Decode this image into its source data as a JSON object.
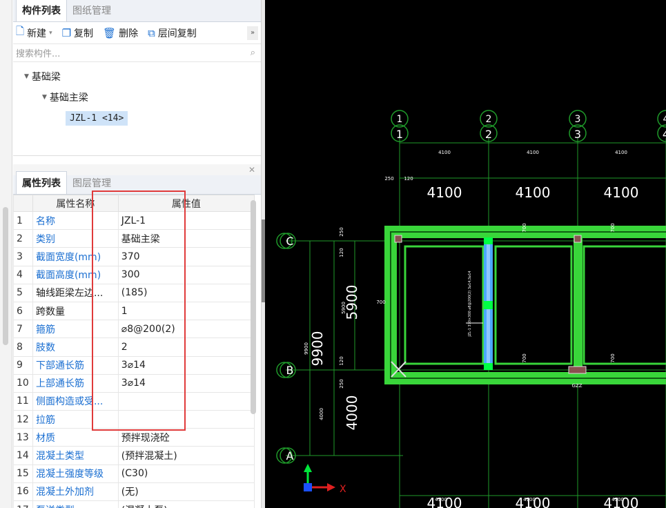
{
  "component_panel": {
    "tabs": [
      "构件列表",
      "图纸管理"
    ],
    "toolbar": {
      "new_label": "新建",
      "copy_label": "复制",
      "delete_label": "删除",
      "floor_copy_label": "层间复制"
    },
    "search_placeholder": "搜索构件...",
    "tree": {
      "level1": "基础梁",
      "level2": "基础主梁",
      "item": "JZL-1 <14>"
    }
  },
  "property_panel": {
    "tabs": [
      "属性列表",
      "图层管理"
    ],
    "columns": [
      "属性名称",
      "属性值"
    ],
    "rows": [
      {
        "idx": "1",
        "name": "名称",
        "value": "JZL-1",
        "blue": true
      },
      {
        "idx": "2",
        "name": "类别",
        "value": "基础主梁",
        "blue": true
      },
      {
        "idx": "3",
        "name": "截面宽度(mm)",
        "value": "370",
        "blue": true
      },
      {
        "idx": "4",
        "name": "截面高度(mm)",
        "value": "300",
        "blue": true
      },
      {
        "idx": "5",
        "name": "轴线距梁左边...",
        "value": "(185)",
        "blue": false
      },
      {
        "idx": "6",
        "name": "跨数量",
        "value": "1",
        "blue": false
      },
      {
        "idx": "7",
        "name": "箍筋",
        "value": "⌀8@200(2)",
        "blue": true
      },
      {
        "idx": "8",
        "name": "肢数",
        "value": "2",
        "blue": true
      },
      {
        "idx": "9",
        "name": "下部通长筋",
        "value": "3⌀14",
        "blue": true
      },
      {
        "idx": "10",
        "name": "上部通长筋",
        "value": "3⌀14",
        "blue": true
      },
      {
        "idx": "11",
        "name": "侧面构造或受...",
        "value": "",
        "blue": true
      },
      {
        "idx": "12",
        "name": "拉筋",
        "value": "",
        "blue": true
      },
      {
        "idx": "13",
        "name": "材质",
        "value": "预拌现浇砼",
        "blue": true
      },
      {
        "idx": "14",
        "name": "混凝土类型",
        "value": "(预拌混凝土)",
        "blue": true
      },
      {
        "idx": "15",
        "name": "混凝土强度等级",
        "value": "(C30)",
        "blue": true
      },
      {
        "idx": "16",
        "name": "混凝土外加剂",
        "value": "(无)",
        "blue": true
      },
      {
        "idx": "17",
        "name": "泵送类型",
        "value": "(混凝土泵)",
        "blue": true
      }
    ]
  },
  "cad": {
    "axes_top": [
      "1",
      "2",
      "3",
      "4"
    ],
    "axes_left": [
      "C",
      "B",
      "A"
    ],
    "small_dims_top": [
      "4100",
      "4100",
      "4100"
    ],
    "big_dims_top": [
      "4100",
      "4100",
      "4100"
    ],
    "big_dims_bottom": [
      "4100",
      "4100",
      "4100"
    ],
    "small_dims_bottom": [
      "4100",
      "4100",
      "4100"
    ],
    "dim_left_span1": "5900",
    "dim_left_span2": "4000",
    "dim_left_total": "9900",
    "small_left_span1": "5900",
    "small_left_span2": "4000",
    "small_left_total": "9900",
    "small_250_a": "250",
    "small_120_a": "120",
    "small_250_b": "250",
    "small_120_b": "120",
    "small_250_top": "250",
    "small_120_top": "120",
    "beam_label_700": "700",
    "beam_label_a": "700",
    "beam_label_b": "700",
    "beam_label_c": "700",
    "beam_label_d": "700",
    "beam_label_bottom": "GZZ",
    "beam_annotation": "JZL-1 370×300 ⌀8@200(2) 3⌀14;3⌀14",
    "ucs_x": "X",
    "colors": {
      "background": "#000000",
      "grid_line": "#1f9a2a",
      "beam_green": "#39d63a",
      "beam_selected": "#4aa8ff",
      "text": "#ffffff"
    }
  }
}
